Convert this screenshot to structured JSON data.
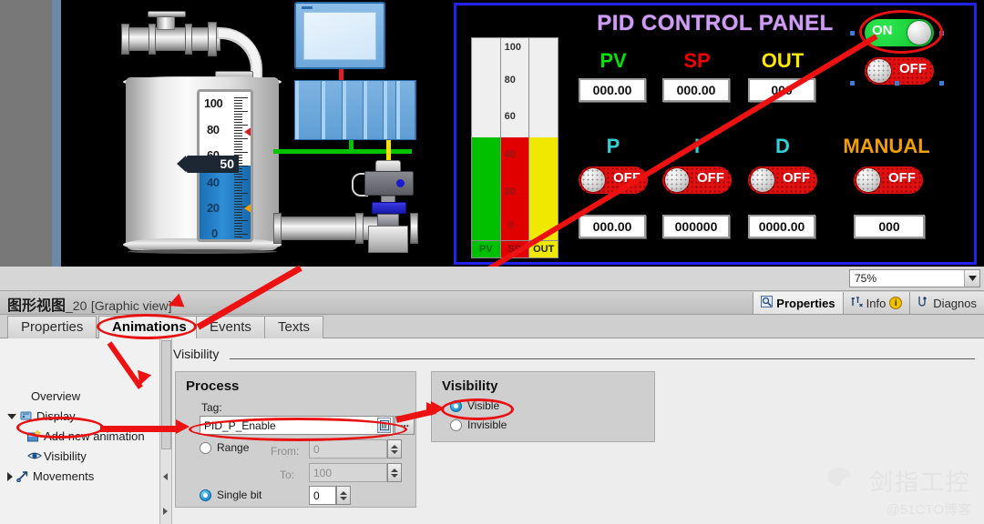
{
  "canvas": {
    "zoom_level": "75%",
    "gauge": {
      "labels": [
        "100",
        "80",
        "60",
        "40",
        "20",
        "0"
      ],
      "pointer_value": "50",
      "fill_percent": 50
    },
    "pid_panel": {
      "title": "PID CONTROL PANEL",
      "title_color": "#cf9cf5",
      "border_color": "#2222ee",
      "tribar": {
        "scale_labels": [
          "100",
          "80",
          "60",
          "40",
          "20",
          "0"
        ],
        "columns": [
          {
            "label": "PV",
            "color": "#00c000",
            "fill_percent": 45
          },
          {
            "label": "SP",
            "color": "#e00000",
            "fill_percent": 45
          },
          {
            "label": "OUT",
            "color": "#f0e800",
            "fill_percent": 45
          }
        ]
      },
      "top_row": [
        {
          "label": "PV",
          "color": "#00e400",
          "value": "000.00"
        },
        {
          "label": "SP",
          "color": "#ee0000",
          "value": "000.00"
        },
        {
          "label": "OUT",
          "color": "#ffe800",
          "value": "000"
        }
      ],
      "bottom_row": [
        {
          "label": "P",
          "color": "#2fd0d8",
          "toggle": "OFF",
          "toggle_state": "off",
          "value": "000.00"
        },
        {
          "label": "I",
          "color": "#2fd0d8",
          "toggle": "OFF",
          "toggle_state": "off",
          "value": "000000"
        },
        {
          "label": "D",
          "color": "#2fd0d8",
          "toggle": "OFF",
          "toggle_state": "off",
          "value": "0000.00"
        },
        {
          "label": "MANUAL",
          "color": "#f0a000",
          "toggle": "OFF",
          "toggle_state": "off",
          "value": "000"
        }
      ],
      "power_toggles": [
        {
          "label": "ON",
          "state": "on"
        },
        {
          "label": "OFF",
          "state": "off"
        }
      ]
    }
  },
  "pane": {
    "title_zh": "图形视图",
    "title_suffix": "_20",
    "title_bracket": "[Graphic view]",
    "right_tabs": [
      {
        "label": "Properties",
        "icon": "properties-icon",
        "active": true
      },
      {
        "label": "Info",
        "icon": "info-icon",
        "badge": "i",
        "active": false
      },
      {
        "label": "Diagnos",
        "icon": "diagnostics-icon",
        "active": false
      }
    ],
    "tabs": [
      {
        "label": "Properties",
        "active": false
      },
      {
        "label": "Animations",
        "active": true
      },
      {
        "label": "Events",
        "active": false
      },
      {
        "label": "Texts",
        "active": false
      }
    ],
    "tree": [
      {
        "label": "Overview",
        "indent": 0,
        "twist": "none",
        "icon": "none"
      },
      {
        "label": "Display",
        "indent": 0,
        "twist": "open",
        "icon": "display-icon"
      },
      {
        "label": "Add new animation",
        "indent": 1,
        "twist": "none",
        "icon": "add-animation-icon"
      },
      {
        "label": "Visibility",
        "indent": 1,
        "twist": "none",
        "icon": "eye-icon"
      },
      {
        "label": "Movements",
        "indent": 0,
        "twist": "closed",
        "icon": "movements-icon"
      }
    ],
    "section_label": "Visibility",
    "process_group": {
      "title": "Process",
      "tag_label": "Tag:",
      "tag_value": "PID_P_Enable",
      "tag_browse_label": "...",
      "range_label": "Range",
      "range_selected": false,
      "from_label": "From:",
      "from_value": "0",
      "to_label": "To:",
      "to_value": "100",
      "single_bit_label": "Single bit",
      "single_bit_selected": true,
      "single_bit_value": "0"
    },
    "visibility_group": {
      "title": "Visibility",
      "options": [
        {
          "label": "Visible",
          "selected": true
        },
        {
          "label": "Invisible",
          "selected": false
        }
      ]
    }
  },
  "watermark": {
    "name": "剑指工控",
    "source": "@51CTO博客"
  }
}
